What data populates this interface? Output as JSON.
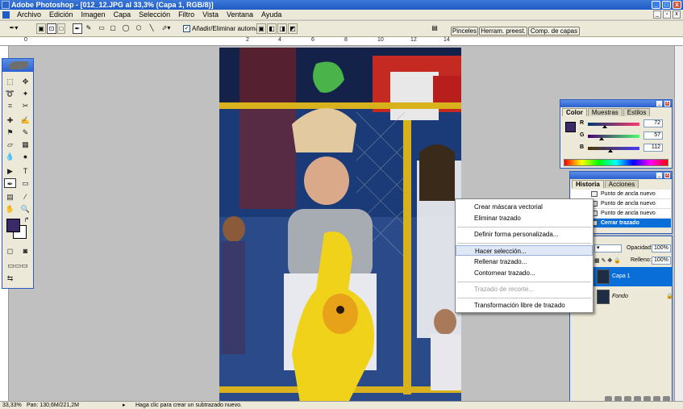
{
  "window": {
    "title": "Adobe Photoshop - [012_12.JPG al 33,3% (Capa 1, RGB/8)]",
    "minimize": "_",
    "maximize": "□",
    "close": "x"
  },
  "menu": [
    "Archivo",
    "Edición",
    "Imagen",
    "Capa",
    "Selección",
    "Filtro",
    "Vista",
    "Ventana",
    "Ayuda"
  ],
  "options_bar": {
    "add_remove_label": "Añadir/Eliminar automát.",
    "add_remove_checked": "✓",
    "palette_tabs": [
      "Pinceles",
      "Herram. preest.",
      "Comp. de capas"
    ]
  },
  "rulers": {
    "h_labels": [
      "0",
      "2",
      "4",
      "6",
      "8",
      "10",
      "12",
      "14"
    ]
  },
  "color_panel": {
    "tabs": [
      "Color",
      "Muestras",
      "Estilos"
    ],
    "channels": [
      {
        "label": "R",
        "value": "72"
      },
      {
        "label": "G",
        "value": "57"
      },
      {
        "label": "B",
        "value": "112"
      }
    ],
    "foreground": "#3a2a68"
  },
  "history_panel": {
    "tabs": [
      "Historia",
      "Acciones"
    ],
    "items": [
      "Punto de ancla nuevo",
      "Punto de ancla nuevo",
      "Punto de ancla nuevo",
      "Cerrar trazado"
    ],
    "selected_index": 3
  },
  "layers_panel": {
    "opacity_label": "Opacidad:",
    "opacity_value": "100%",
    "fill_label": "Relleno:",
    "fill_value": "100%",
    "layers": [
      {
        "name": "Capa 1",
        "selected": true
      },
      {
        "name": "Fondo",
        "selected": false
      }
    ]
  },
  "context_menu": {
    "items": [
      {
        "label": "Crear máscara vectorial",
        "state": "normal"
      },
      {
        "label": "Eliminar trazado",
        "state": "normal"
      },
      {
        "label": "Definir forma personalizada...",
        "state": "normal"
      },
      {
        "label": "Hacer selección...",
        "state": "highlighted"
      },
      {
        "label": "Rellenar trazado...",
        "state": "normal"
      },
      {
        "label": "Contornear trazado...",
        "state": "normal"
      },
      {
        "label": "Trazado de recorte...",
        "state": "disabled"
      },
      {
        "label": "Transformación libre de trazado",
        "state": "normal"
      }
    ]
  },
  "status_bar": {
    "zoom": "33,33%",
    "doc_size": "Pan: 130,6M/221,2M",
    "hint": "Haga clic para crear un subtrazado nuevo."
  }
}
